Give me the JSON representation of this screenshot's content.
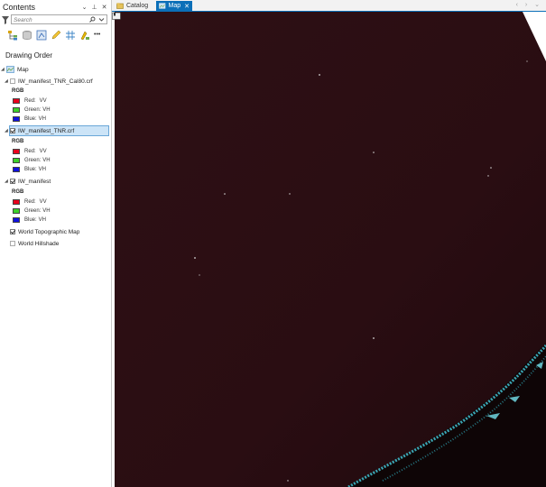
{
  "contents": {
    "title": "Contents",
    "controls": [
      "⌄",
      "⊥",
      "✕"
    ],
    "search": {
      "placeholder": "Search",
      "value": ""
    },
    "toolbar_icons": [
      "list-by-drawing-order-icon",
      "list-by-source-icon",
      "list-by-selection-icon",
      "list-by-editing-icon",
      "list-by-snapping-icon",
      "list-by-labeling-icon",
      "more-icon"
    ],
    "more": "•••",
    "section_title": "Drawing Order",
    "map": {
      "label": "Map"
    },
    "layers": [
      {
        "label": "IW_manifest_TNR_Cal80.crf",
        "checked": false,
        "renderer": "RGB",
        "bands": [
          {
            "channel": "Red:",
            "band": "VV",
            "color": "#e8001c"
          },
          {
            "channel": "Green:",
            "band": "VH",
            "color": "#3cd12a"
          },
          {
            "channel": "Blue:",
            "band": "VH",
            "color": "#1010e0"
          }
        ]
      },
      {
        "label": "IW_manifest_TNR.crf",
        "checked": true,
        "selected": true,
        "renderer": "RGB",
        "bands": [
          {
            "channel": "Red:",
            "band": "VV",
            "color": "#e8001c"
          },
          {
            "channel": "Green:",
            "band": "VH",
            "color": "#3cd12a"
          },
          {
            "channel": "Blue:",
            "band": "VH",
            "color": "#1010e0"
          }
        ]
      },
      {
        "label": "IW_manifest",
        "checked": true,
        "renderer": "RGB",
        "bands": [
          {
            "channel": "Red:",
            "band": "VV",
            "color": "#e8001c"
          },
          {
            "channel": "Green:",
            "band": "VH",
            "color": "#3cd12a"
          },
          {
            "channel": "Blue:",
            "band": "VH",
            "color": "#1010e0"
          }
        ]
      }
    ],
    "basemaps": [
      {
        "label": "World Topographic Map",
        "checked": true
      },
      {
        "label": "World Hillshade",
        "checked": false
      }
    ]
  },
  "tabs": [
    {
      "label": "Catalog",
      "active": false
    },
    {
      "label": "Map",
      "active": true,
      "close": "✕"
    }
  ],
  "nav_arrows": "‹ › ⌄",
  "colors": {
    "accent": "#0b6fb8",
    "map_background": "#2b0e12",
    "coast": "#3fb8c8",
    "selection": "#cce4f7"
  }
}
